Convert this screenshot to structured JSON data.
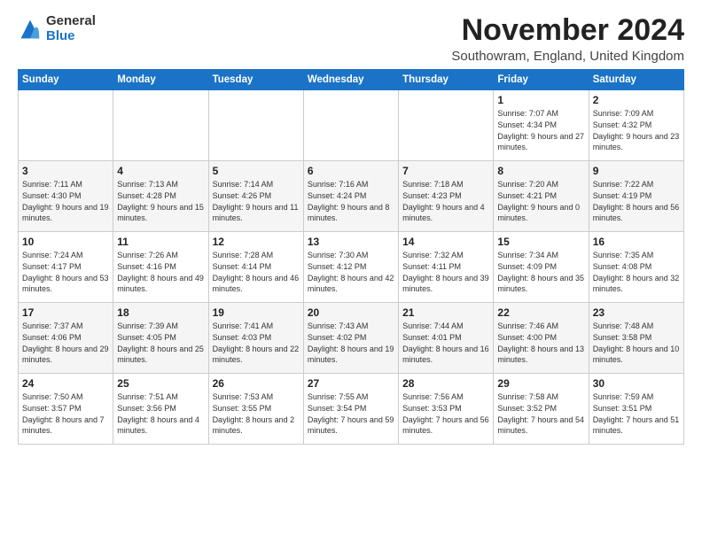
{
  "logo": {
    "general": "General",
    "blue": "Blue"
  },
  "title": "November 2024",
  "location": "Southowram, England, United Kingdom",
  "days_header": [
    "Sunday",
    "Monday",
    "Tuesday",
    "Wednesday",
    "Thursday",
    "Friday",
    "Saturday"
  ],
  "weeks": [
    [
      {
        "day": "",
        "info": ""
      },
      {
        "day": "",
        "info": ""
      },
      {
        "day": "",
        "info": ""
      },
      {
        "day": "",
        "info": ""
      },
      {
        "day": "",
        "info": ""
      },
      {
        "day": "1",
        "info": "Sunrise: 7:07 AM\nSunset: 4:34 PM\nDaylight: 9 hours\nand 27 minutes."
      },
      {
        "day": "2",
        "info": "Sunrise: 7:09 AM\nSunset: 4:32 PM\nDaylight: 9 hours\nand 23 minutes."
      }
    ],
    [
      {
        "day": "3",
        "info": "Sunrise: 7:11 AM\nSunset: 4:30 PM\nDaylight: 9 hours\nand 19 minutes."
      },
      {
        "day": "4",
        "info": "Sunrise: 7:13 AM\nSunset: 4:28 PM\nDaylight: 9 hours\nand 15 minutes."
      },
      {
        "day": "5",
        "info": "Sunrise: 7:14 AM\nSunset: 4:26 PM\nDaylight: 9 hours\nand 11 minutes."
      },
      {
        "day": "6",
        "info": "Sunrise: 7:16 AM\nSunset: 4:24 PM\nDaylight: 9 hours\nand 8 minutes."
      },
      {
        "day": "7",
        "info": "Sunrise: 7:18 AM\nSunset: 4:23 PM\nDaylight: 9 hours\nand 4 minutes."
      },
      {
        "day": "8",
        "info": "Sunrise: 7:20 AM\nSunset: 4:21 PM\nDaylight: 9 hours\nand 0 minutes."
      },
      {
        "day": "9",
        "info": "Sunrise: 7:22 AM\nSunset: 4:19 PM\nDaylight: 8 hours\nand 56 minutes."
      }
    ],
    [
      {
        "day": "10",
        "info": "Sunrise: 7:24 AM\nSunset: 4:17 PM\nDaylight: 8 hours\nand 53 minutes."
      },
      {
        "day": "11",
        "info": "Sunrise: 7:26 AM\nSunset: 4:16 PM\nDaylight: 8 hours\nand 49 minutes."
      },
      {
        "day": "12",
        "info": "Sunrise: 7:28 AM\nSunset: 4:14 PM\nDaylight: 8 hours\nand 46 minutes."
      },
      {
        "day": "13",
        "info": "Sunrise: 7:30 AM\nSunset: 4:12 PM\nDaylight: 8 hours\nand 42 minutes."
      },
      {
        "day": "14",
        "info": "Sunrise: 7:32 AM\nSunset: 4:11 PM\nDaylight: 8 hours\nand 39 minutes."
      },
      {
        "day": "15",
        "info": "Sunrise: 7:34 AM\nSunset: 4:09 PM\nDaylight: 8 hours\nand 35 minutes."
      },
      {
        "day": "16",
        "info": "Sunrise: 7:35 AM\nSunset: 4:08 PM\nDaylight: 8 hours\nand 32 minutes."
      }
    ],
    [
      {
        "day": "17",
        "info": "Sunrise: 7:37 AM\nSunset: 4:06 PM\nDaylight: 8 hours\nand 29 minutes."
      },
      {
        "day": "18",
        "info": "Sunrise: 7:39 AM\nSunset: 4:05 PM\nDaylight: 8 hours\nand 25 minutes."
      },
      {
        "day": "19",
        "info": "Sunrise: 7:41 AM\nSunset: 4:03 PM\nDaylight: 8 hours\nand 22 minutes."
      },
      {
        "day": "20",
        "info": "Sunrise: 7:43 AM\nSunset: 4:02 PM\nDaylight: 8 hours\nand 19 minutes."
      },
      {
        "day": "21",
        "info": "Sunrise: 7:44 AM\nSunset: 4:01 PM\nDaylight: 8 hours\nand 16 minutes."
      },
      {
        "day": "22",
        "info": "Sunrise: 7:46 AM\nSunset: 4:00 PM\nDaylight: 8 hours\nand 13 minutes."
      },
      {
        "day": "23",
        "info": "Sunrise: 7:48 AM\nSunset: 3:58 PM\nDaylight: 8 hours\nand 10 minutes."
      }
    ],
    [
      {
        "day": "24",
        "info": "Sunrise: 7:50 AM\nSunset: 3:57 PM\nDaylight: 8 hours\nand 7 minutes."
      },
      {
        "day": "25",
        "info": "Sunrise: 7:51 AM\nSunset: 3:56 PM\nDaylight: 8 hours\nand 4 minutes."
      },
      {
        "day": "26",
        "info": "Sunrise: 7:53 AM\nSunset: 3:55 PM\nDaylight: 8 hours\nand 2 minutes."
      },
      {
        "day": "27",
        "info": "Sunrise: 7:55 AM\nSunset: 3:54 PM\nDaylight: 7 hours\nand 59 minutes."
      },
      {
        "day": "28",
        "info": "Sunrise: 7:56 AM\nSunset: 3:53 PM\nDaylight: 7 hours\nand 56 minutes."
      },
      {
        "day": "29",
        "info": "Sunrise: 7:58 AM\nSunset: 3:52 PM\nDaylight: 7 hours\nand 54 minutes."
      },
      {
        "day": "30",
        "info": "Sunrise: 7:59 AM\nSunset: 3:51 PM\nDaylight: 7 hours\nand 51 minutes."
      }
    ]
  ]
}
